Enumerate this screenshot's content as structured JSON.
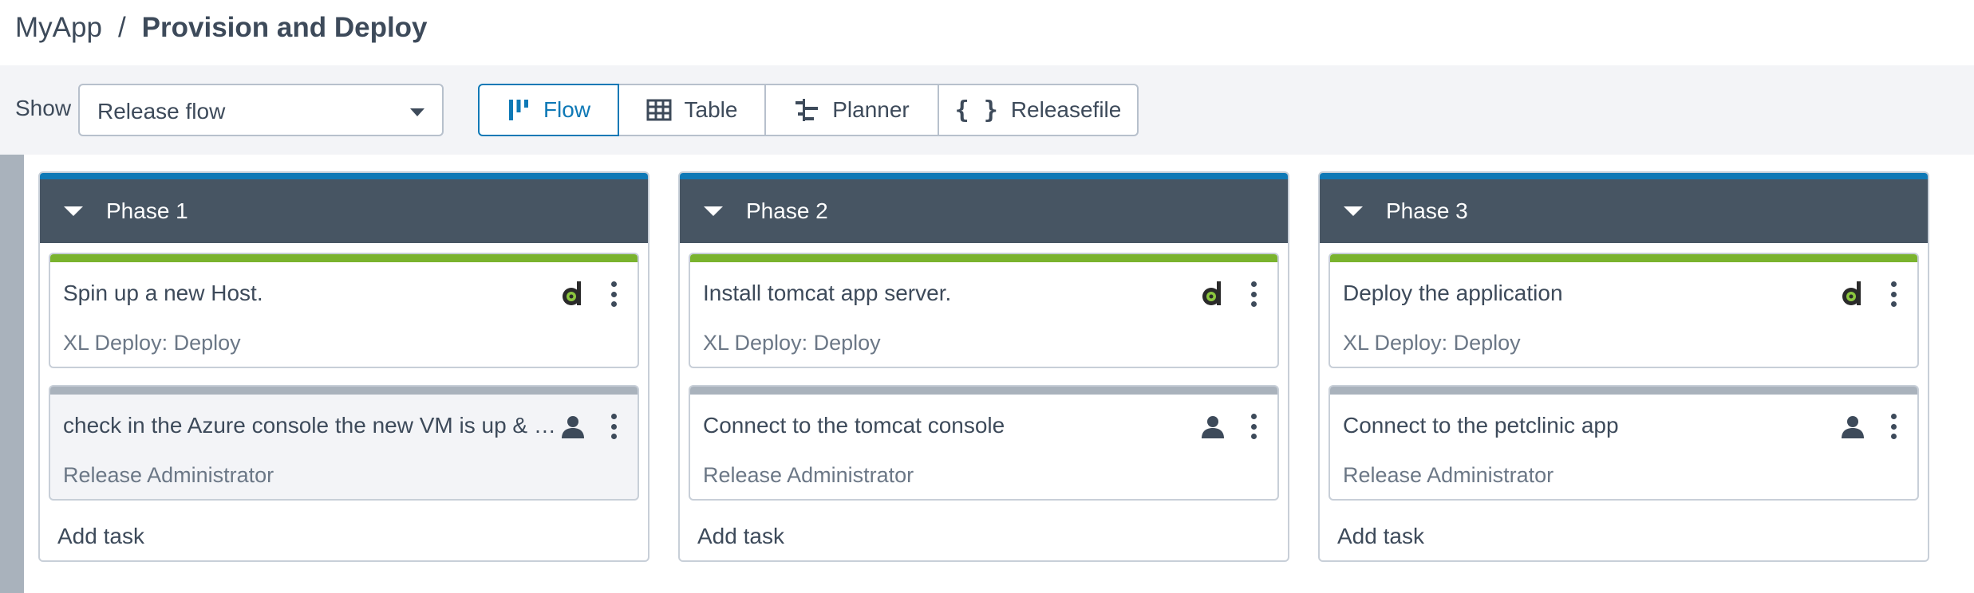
{
  "breadcrumb": {
    "app": "MyApp",
    "separator": "/",
    "current": "Provision and Deploy"
  },
  "toolbar": {
    "show_label": "Show",
    "view_select": {
      "value": "Release flow"
    },
    "views": [
      {
        "label": "Flow",
        "icon": "flow-icon",
        "active": true
      },
      {
        "label": "Table",
        "icon": "table-icon",
        "active": false
      },
      {
        "label": "Planner",
        "icon": "planner-icon",
        "active": false
      },
      {
        "label": "Releasefile",
        "icon": "braces-icon",
        "active": false
      }
    ]
  },
  "colors": {
    "accent": "#0f79b6",
    "phase_header": "#475563",
    "automated_task_bar": "#7ab32e",
    "manual_task_bar": "#a9b2bc"
  },
  "phases": [
    {
      "title": "Phase 1",
      "tasks": [
        {
          "title": "Spin up a new Host.",
          "subtitle": "XL Deploy: Deploy",
          "icon": "xl-deploy-icon",
          "type": "automated"
        },
        {
          "title": "check in the Azure console the new VM is up & r...",
          "subtitle": "Release Administrator",
          "icon": "user-icon",
          "type": "manual"
        }
      ],
      "add_task_label": "Add task"
    },
    {
      "title": "Phase 2",
      "tasks": [
        {
          "title": "Install tomcat app server.",
          "subtitle": "XL Deploy: Deploy",
          "icon": "xl-deploy-icon",
          "type": "automated"
        },
        {
          "title": "Connect to the tomcat console",
          "subtitle": "Release Administrator",
          "icon": "user-icon",
          "type": "manual"
        }
      ],
      "add_task_label": "Add task"
    },
    {
      "title": "Phase 3",
      "tasks": [
        {
          "title": "Deploy the application",
          "subtitle": "XL Deploy: Deploy",
          "icon": "xl-deploy-icon",
          "type": "automated"
        },
        {
          "title": "Connect to the petclinic app",
          "subtitle": "Release Administrator",
          "icon": "user-icon",
          "type": "manual"
        }
      ],
      "add_task_label": "Add task"
    }
  ]
}
